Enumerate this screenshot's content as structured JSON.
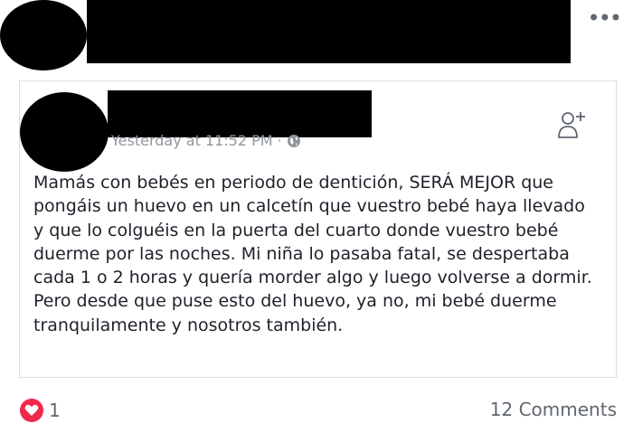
{
  "post": {
    "shared": {
      "timestamp": "Yesterday at 11:52 PM",
      "separator": "·",
      "privacy_icon": "globe-icon",
      "add_friend_icon": "add-friend-icon",
      "body": "Mamás con bebés en periodo de dentición, SERÁ MEJOR que\npongáis un huevo en un calcetín que vuestro bebé haya llevado\ny que lo colguéis en la puerta del cuarto donde vuestro bebé\nduerme por las noches. Mi niña lo pasaba fatal, se despertaba\ncada 1 o 2 horas y quería morder algo y luego volverse a dormir.\nPero desde que puse esto del huevo, ya no, mi bebé duerme\ntranquilamente y nosotros también."
    },
    "more_icon": "more-options-icon",
    "more_label": "•••",
    "reactions": {
      "icon": "heart-icon",
      "count": "1",
      "color": "#f0284a"
    },
    "comments_label": "12 Comments"
  }
}
